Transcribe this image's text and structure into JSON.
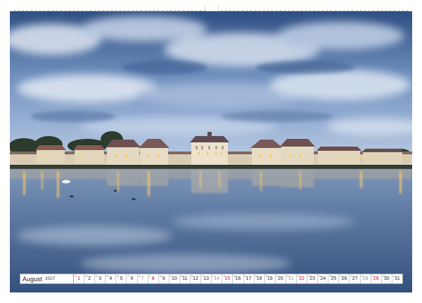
{
  "calendar": {
    "month": "August",
    "year": "2027",
    "days": [
      {
        "n": "1",
        "w": "S",
        "type": "sun"
      },
      {
        "n": "2",
        "w": "M",
        "type": "weekday"
      },
      {
        "n": "3",
        "w": "D",
        "type": "weekday"
      },
      {
        "n": "4",
        "w": "M",
        "type": "weekday"
      },
      {
        "n": "5",
        "w": "D",
        "type": "weekday"
      },
      {
        "n": "6",
        "w": "F",
        "type": "weekday"
      },
      {
        "n": "7",
        "w": "S",
        "type": "sat"
      },
      {
        "n": "8",
        "w": "S",
        "type": "sun"
      },
      {
        "n": "9",
        "w": "M",
        "type": "weekday"
      },
      {
        "n": "10",
        "w": "D",
        "type": "weekday"
      },
      {
        "n": "11",
        "w": "M",
        "type": "weekday"
      },
      {
        "n": "12",
        "w": "D",
        "type": "weekday"
      },
      {
        "n": "13",
        "w": "F",
        "type": "weekday"
      },
      {
        "n": "14",
        "w": "S",
        "type": "sat"
      },
      {
        "n": "15",
        "w": "S",
        "type": "sun"
      },
      {
        "n": "16",
        "w": "M",
        "type": "weekday"
      },
      {
        "n": "17",
        "w": "D",
        "type": "weekday"
      },
      {
        "n": "18",
        "w": "M",
        "type": "weekday"
      },
      {
        "n": "19",
        "w": "D",
        "type": "weekday"
      },
      {
        "n": "20",
        "w": "F",
        "type": "weekday"
      },
      {
        "n": "21",
        "w": "S",
        "type": "sat"
      },
      {
        "n": "22",
        "w": "S",
        "type": "sun"
      },
      {
        "n": "23",
        "w": "M",
        "type": "weekday"
      },
      {
        "n": "24",
        "w": "D",
        "type": "weekday"
      },
      {
        "n": "25",
        "w": "M",
        "type": "weekday"
      },
      {
        "n": "26",
        "w": "D",
        "type": "weekday"
      },
      {
        "n": "27",
        "w": "F",
        "type": "weekday"
      },
      {
        "n": "28",
        "w": "S",
        "type": "sat"
      },
      {
        "n": "29",
        "w": "S",
        "type": "sun"
      },
      {
        "n": "30",
        "w": "M",
        "type": "weekday"
      },
      {
        "n": "31",
        "w": "D",
        "type": "weekday"
      }
    ]
  },
  "colors": {
    "sunday": "#d0021b",
    "saturday": "#8c8c8c",
    "sky_top": "#2f4f82",
    "water": "#3f5f8c",
    "lights": "#f6c86a"
  }
}
